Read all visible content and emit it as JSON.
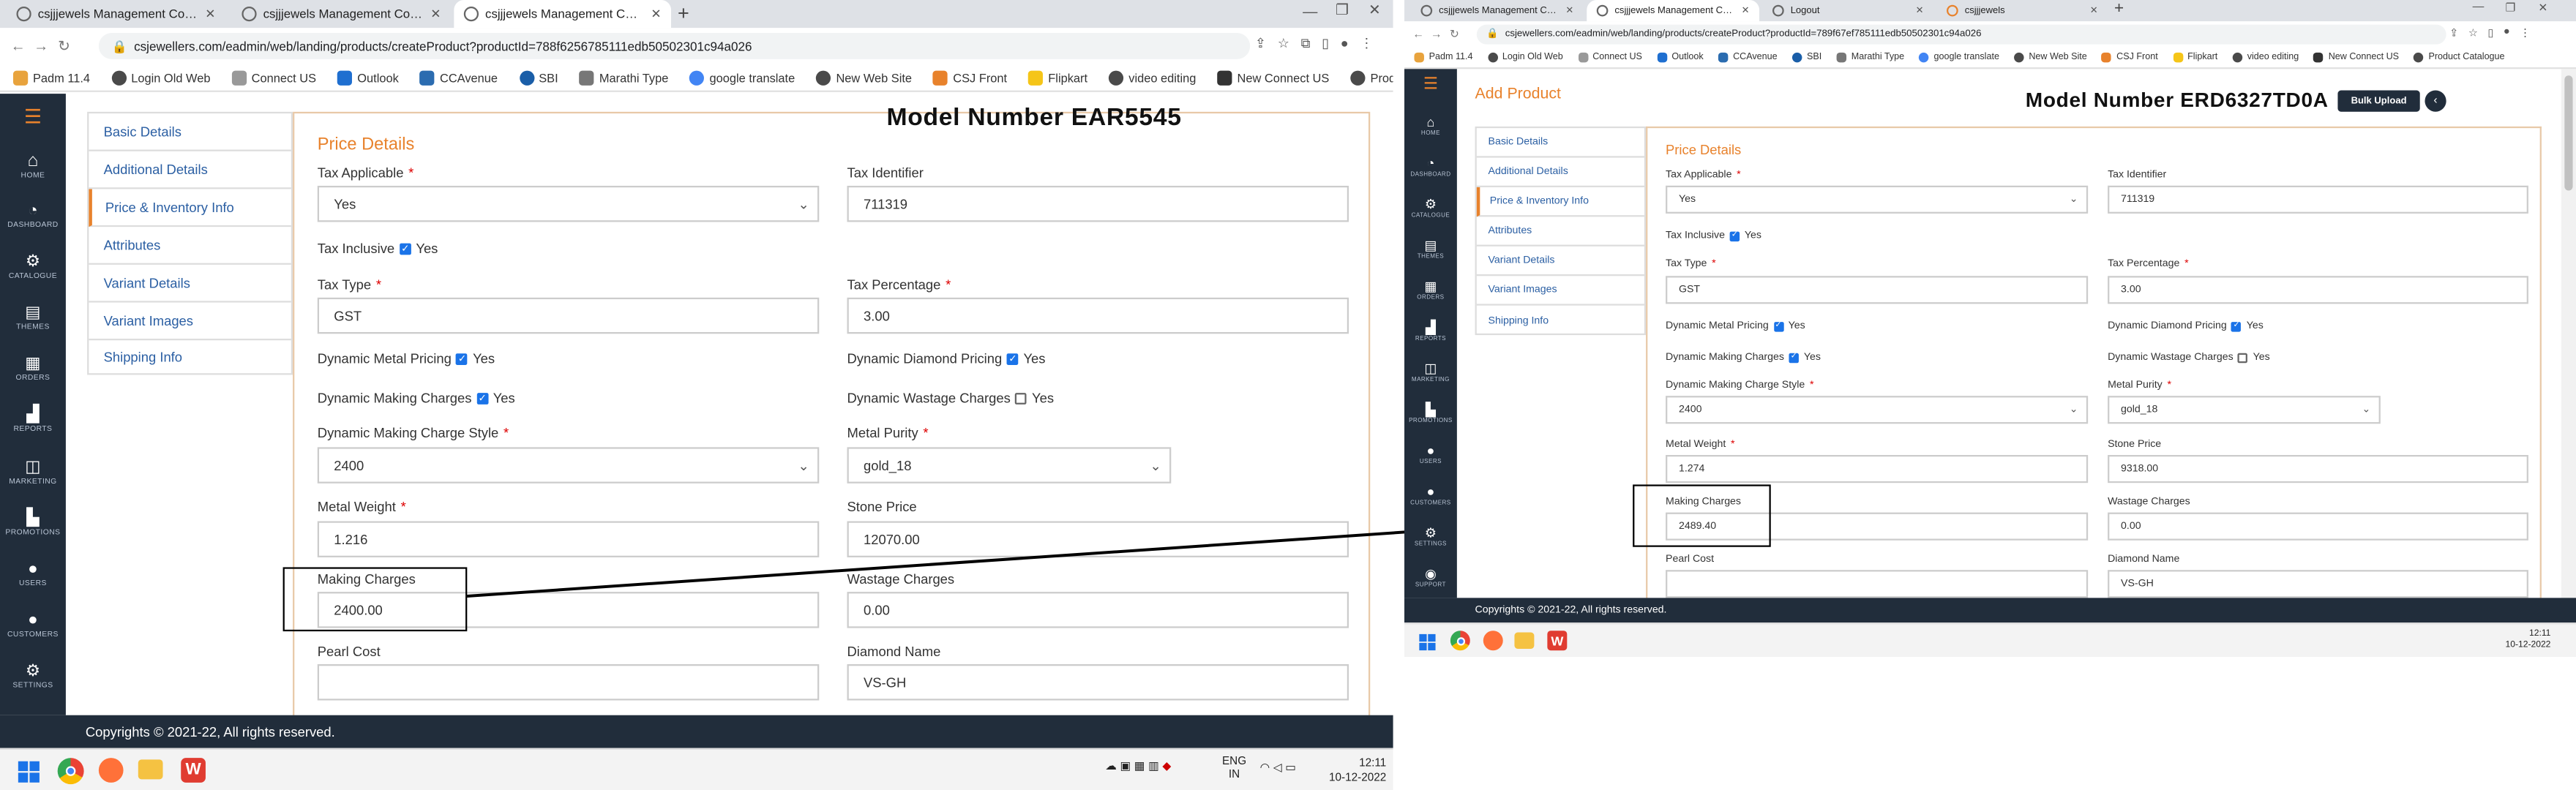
{
  "left": {
    "tabs": [
      "csjjjewels Management Console",
      "csjjjewels Management Console",
      "csjjjewels Management Console"
    ],
    "url": "csjewellers.com/eadmin/web/landing/products/createProduct?productId=788f6256785111edb50502301c94a026",
    "bookmarks": [
      "Padm 11.4",
      "Login Old Web",
      "Connect US",
      "Outlook",
      "CCAvenue",
      "SBI",
      "Marathi Type",
      "google translate",
      "New Web Site",
      "CSJ Front",
      "Flipkart",
      "video editing",
      "New Connect US",
      "Product Catalogue"
    ],
    "sidebar": [
      {
        "label": "HOME",
        "icon": "home-icon"
      },
      {
        "label": "DASHBOARD",
        "icon": "dashboard-icon"
      },
      {
        "label": "CATALOGUE",
        "icon": "catalogue-icon"
      },
      {
        "label": "THEMES",
        "icon": "themes-icon"
      },
      {
        "label": "ORDERS",
        "icon": "orders-icon"
      },
      {
        "label": "REPORTS",
        "icon": "reports-icon"
      },
      {
        "label": "MARKETING",
        "icon": "marketing-icon"
      },
      {
        "label": "PROMOTIONS",
        "icon": "promotions-icon"
      },
      {
        "label": "USERS",
        "icon": "users-icon"
      },
      {
        "label": "CUSTOMERS",
        "icon": "customers-icon"
      },
      {
        "label": "SETTINGS",
        "icon": "settings-icon"
      }
    ],
    "nav": [
      "Basic Details",
      "Additional Details",
      "Price & Inventory Info",
      "Attributes",
      "Variant Details",
      "Variant Images",
      "Shipping Info"
    ],
    "section_title": "Price Details",
    "model_number": "Model Number EAR5545",
    "fields": {
      "tax_applicable_label": "Tax Applicable",
      "tax_applicable_value": "Yes",
      "tax_identifier_label": "Tax Identifier",
      "tax_identifier_value": "711319",
      "tax_inclusive_label": "Tax Inclusive",
      "yes": "Yes",
      "tax_type_label": "Tax Type",
      "tax_type_value": "GST",
      "tax_percentage_label": "Tax Percentage",
      "tax_percentage_value": "3.00",
      "dyn_metal_label": "Dynamic Metal Pricing",
      "dyn_diamond_label": "Dynamic Diamond Pricing",
      "dyn_making_label": "Dynamic Making Charges",
      "dyn_wastage_label": "Dynamic Wastage Charges",
      "making_style_label": "Dynamic Making Charge Style",
      "making_style_value": "2400",
      "metal_purity_label": "Metal Purity",
      "metal_purity_value": "gold_18",
      "metal_weight_label": "Metal Weight",
      "metal_weight_value": "1.216",
      "stone_price_label": "Stone Price",
      "stone_price_value": "12070.00",
      "making_charges_label": "Making Charges",
      "making_charges_value": "2400.00",
      "wastage_label": "Wastage Charges",
      "wastage_value": "0.00",
      "pearl_label": "Pearl Cost",
      "pearl_value": "",
      "diamond_name_label": "Diamond Name",
      "diamond_name_value": "VS-GH"
    },
    "footer": "Copyrights © 2021-22, All rights reserved.",
    "tray": {
      "lang1": "ENG",
      "lang2": "IN",
      "time": "12:11",
      "date": "10-12-2022"
    }
  },
  "right": {
    "tabs": [
      "csjjjewels Management Console",
      "csjjjewels Management Console",
      "Logout",
      "csjjjewels"
    ],
    "url": "csjewellers.com/eadmin/web/landing/products/createProduct?productId=789f67ef785111edb50502301c94a026",
    "bookmarks": [
      "Padm 11.4",
      "Login Old Web",
      "Connect US",
      "Outlook",
      "CCAvenue",
      "SBI",
      "Marathi Type",
      "google translate",
      "New Web Site",
      "CSJ Front",
      "Flipkart",
      "video editing",
      "New Connect US",
      "Product Catalogue"
    ],
    "sidebar": [
      {
        "label": "HOME",
        "icon": "home-icon"
      },
      {
        "label": "DASHBOARD",
        "icon": "dashboard-icon"
      },
      {
        "label": "CATALOGUE",
        "icon": "catalogue-icon"
      },
      {
        "label": "THEMES",
        "icon": "themes-icon"
      },
      {
        "label": "ORDERS",
        "icon": "orders-icon"
      },
      {
        "label": "REPORTS",
        "icon": "reports-icon"
      },
      {
        "label": "MARKETING",
        "icon": "marketing-icon"
      },
      {
        "label": "PROMOTIONS",
        "icon": "promotions-icon"
      },
      {
        "label": "USERS",
        "icon": "users-icon"
      },
      {
        "label": "CUSTOMERS",
        "icon": "customers-icon"
      },
      {
        "label": "SETTINGS",
        "icon": "settings-icon"
      },
      {
        "label": "SUPPORT",
        "icon": "support-icon"
      }
    ],
    "page_title": "Add Product",
    "bulk_upload": "Bulk Upload",
    "nav": [
      "Basic Details",
      "Additional Details",
      "Price & Inventory Info",
      "Attributes",
      "Variant Details",
      "Variant Images",
      "Shipping Info"
    ],
    "section_title": "Price Details",
    "model_number": "Model Number ERD6327TD0A",
    "fields": {
      "tax_applicable_label": "Tax Applicable",
      "tax_applicable_value": "Yes",
      "tax_identifier_label": "Tax Identifier",
      "tax_identifier_value": "711319",
      "tax_inclusive_label": "Tax Inclusive",
      "yes": "Yes",
      "tax_type_label": "Tax Type",
      "tax_type_value": "GST",
      "tax_percentage_label": "Tax Percentage",
      "tax_percentage_value": "3.00",
      "dyn_metal_label": "Dynamic Metal Pricing",
      "dyn_diamond_label": "Dynamic Diamond Pricing",
      "dyn_making_label": "Dynamic Making Charges",
      "dyn_wastage_label": "Dynamic Wastage Charges",
      "making_style_label": "Dynamic Making Charge Style",
      "making_style_value": "2400",
      "metal_purity_label": "Metal Purity",
      "metal_purity_value": "gold_18",
      "metal_weight_label": "Metal Weight",
      "metal_weight_value": "1.274",
      "stone_price_label": "Stone Price",
      "stone_price_value": "9318.00",
      "making_charges_label": "Making Charges",
      "making_charges_value": "2489.40",
      "wastage_label": "Wastage Charges",
      "wastage_value": "0.00",
      "pearl_label": "Pearl Cost",
      "pearl_value": "",
      "diamond_name_label": "Diamond Name",
      "diamond_name_value": "VS-GH"
    },
    "footer": "Copyrights © 2021-22, All rights reserved.",
    "tray": {
      "time": "12:11",
      "date": "10-12-2022"
    }
  },
  "colors": {
    "accent": "#e8822c",
    "sidebar": "#212d3b",
    "link": "#2b5fa3",
    "checkbox": "#1a73e8"
  }
}
